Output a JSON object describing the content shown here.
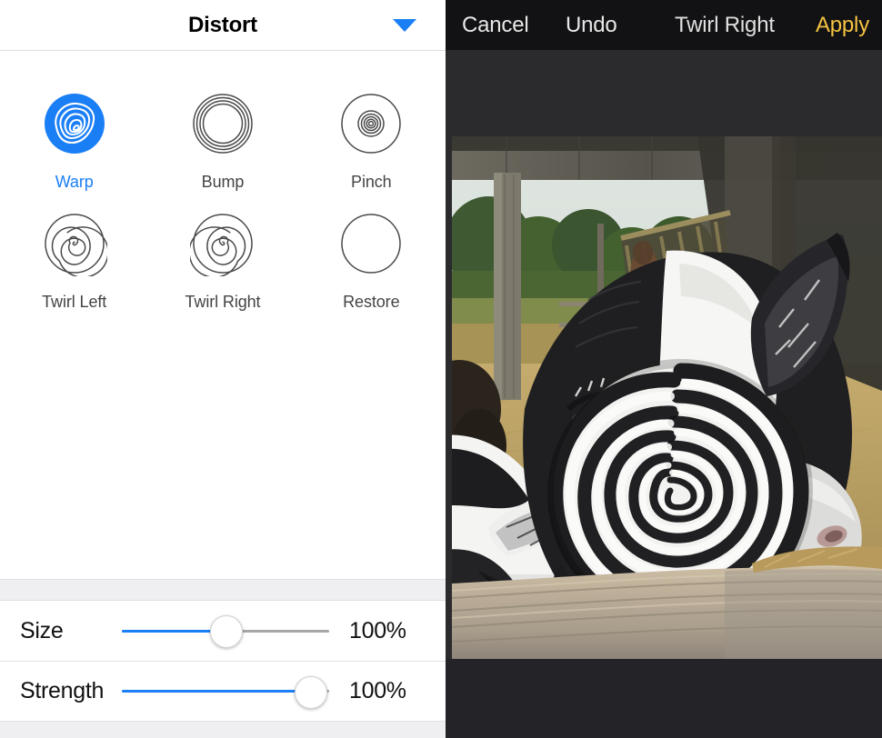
{
  "panel": {
    "title": "Distort",
    "collapse_icon": "triangle-down-icon",
    "accent_color": "#1a7ef5"
  },
  "tools": [
    {
      "id": "warp",
      "label": "Warp",
      "icon": "warp-icon",
      "selected": true
    },
    {
      "id": "bump",
      "label": "Bump",
      "icon": "bump-icon",
      "selected": false
    },
    {
      "id": "pinch",
      "label": "Pinch",
      "icon": "pinch-icon",
      "selected": false
    },
    {
      "id": "twirl-left",
      "label": "Twirl Left",
      "icon": "spiral-ccw-icon",
      "selected": false
    },
    {
      "id": "twirl-right",
      "label": "Twirl Right",
      "icon": "spiral-cw-icon",
      "selected": false
    },
    {
      "id": "restore",
      "label": "Restore",
      "icon": "circle-icon",
      "selected": false
    }
  ],
  "sliders": [
    {
      "id": "size",
      "label": "Size",
      "value": "100%",
      "thumb_pct": 50,
      "fill_pct": 50
    },
    {
      "id": "strength",
      "label": "Strength",
      "value": "100%",
      "thumb_pct": 91,
      "fill_pct": 91
    }
  ],
  "toolbar": {
    "cancel": "Cancel",
    "undo": "Undo",
    "mode": "Twirl Right",
    "apply": "Apply",
    "apply_color": "#f5c342"
  },
  "photo": {
    "subject": "black-and-white goat close-up in a barn with twirl distortion applied to its cheek",
    "alt": "Goat photo with swirl effect"
  }
}
